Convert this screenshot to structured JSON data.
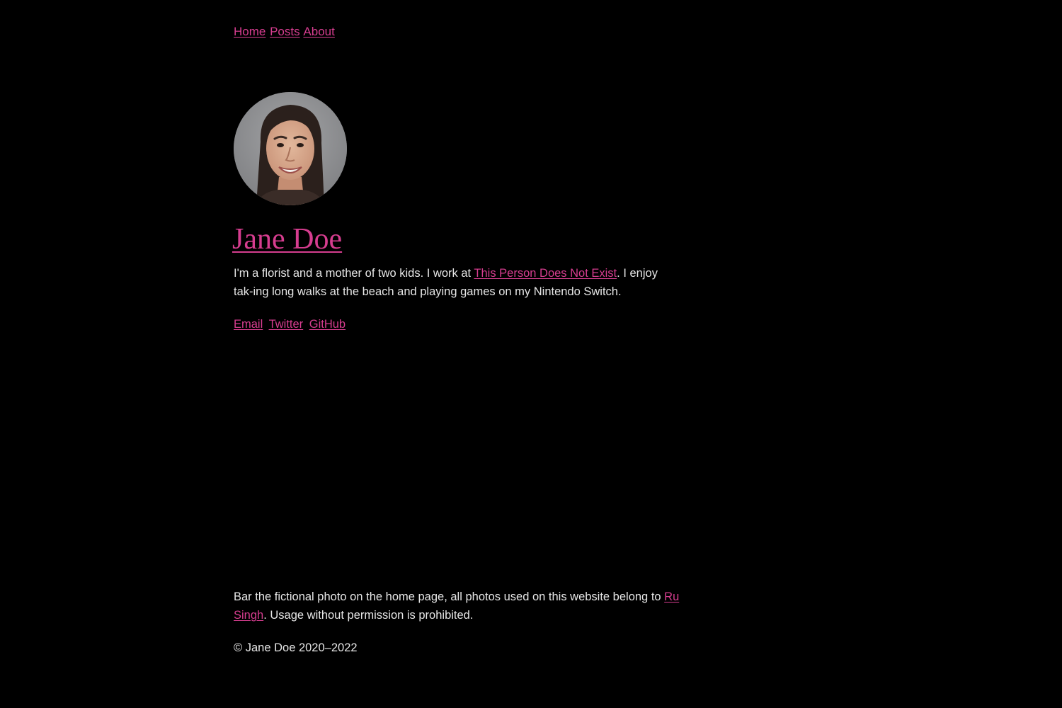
{
  "nav": {
    "home": "Home",
    "posts": "Posts",
    "about": "About"
  },
  "profile": {
    "name": "Jane Doe",
    "avatar_icon": "portrait-photo",
    "bio_before": "I'm a florist and a mother of two kids. I work at ",
    "bio_link": "This Person Does Not Exist",
    "bio_after": ". I enjoy tak-ing long walks at the beach and playing games on my Nintendo Switch."
  },
  "social": {
    "email": "Email",
    "twitter": "Twitter",
    "github": "GitHub"
  },
  "footer": {
    "note_before": "Bar the fictional photo on the home page, all photos used on this website belong to ",
    "note_link": "Ru Singh",
    "note_after": ". Usage without permission is prohibited.",
    "copyright": "© Jane Doe 2020–2022"
  },
  "colors": {
    "background": "#000000",
    "accent": "#d63d8f",
    "text": "#e6e6e6"
  }
}
